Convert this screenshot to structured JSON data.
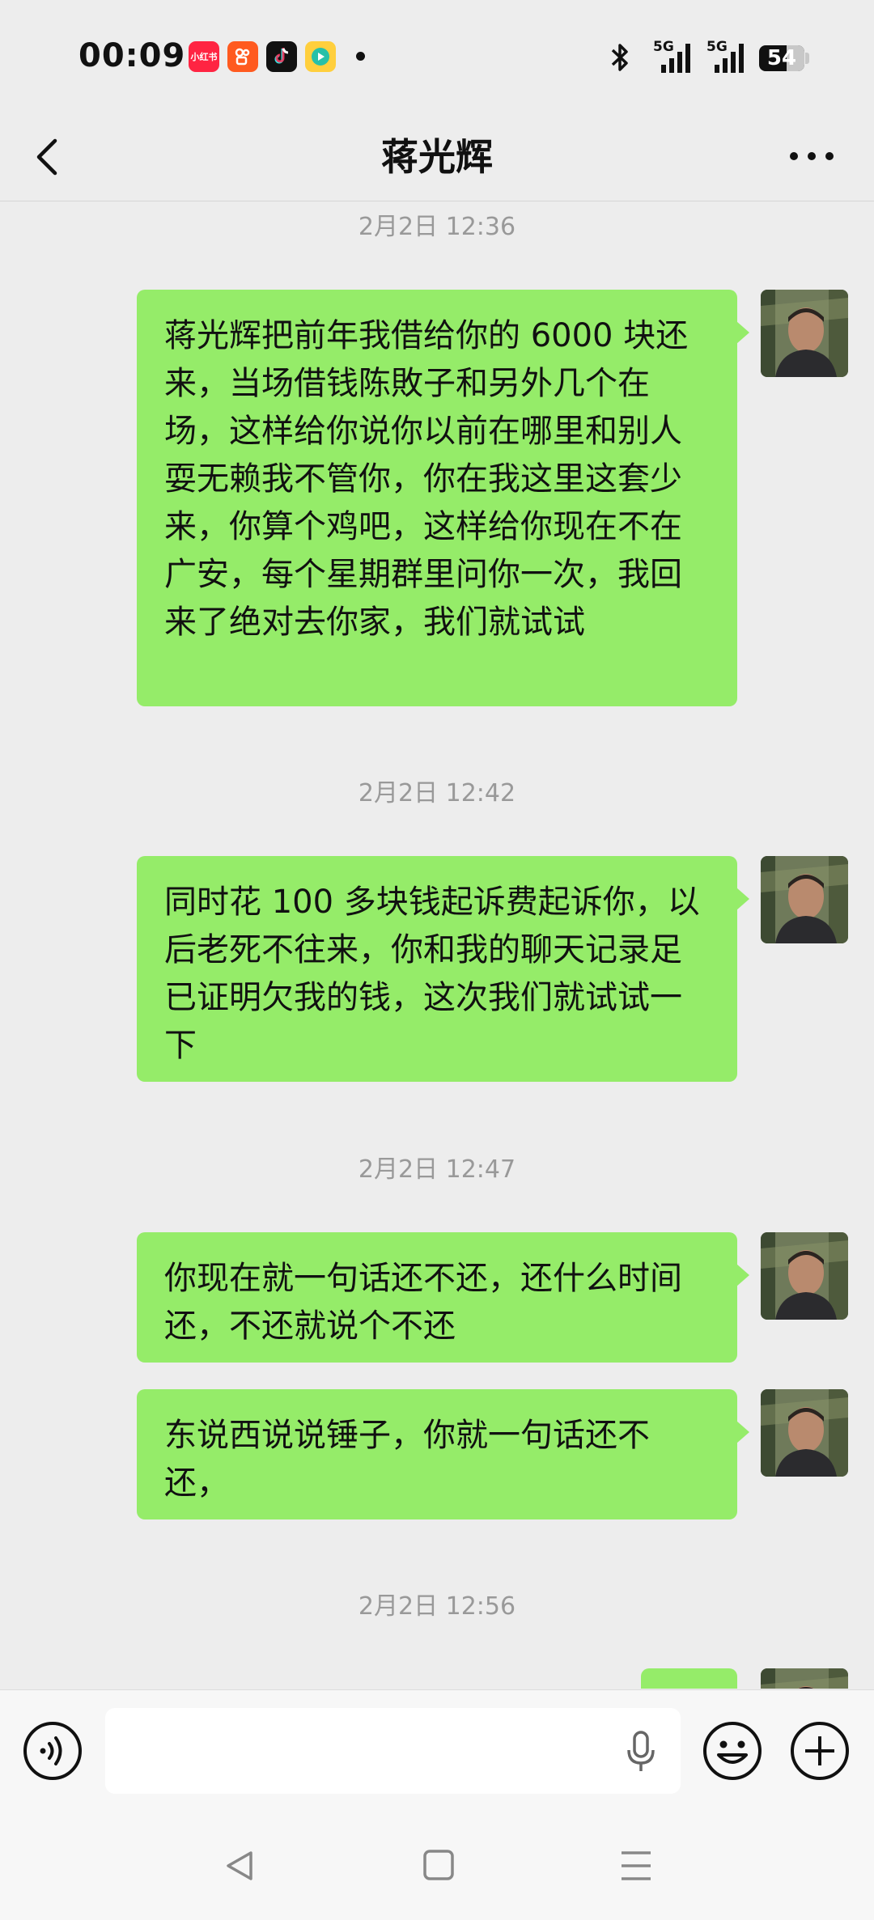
{
  "status_bar": {
    "time": "00:09",
    "app_icons": [
      "xiaohongshu-icon",
      "kuaishou-icon",
      "douyin-icon",
      "video-app-icon"
    ],
    "app_icon_label": "小红书",
    "network_1": "5G",
    "network_2": "5G",
    "battery": "54"
  },
  "header": {
    "title": "蒋光辉"
  },
  "messages": [
    {
      "timestamp": "2月2日 12:36",
      "text": "蒋光辉把前年我借给你的 6000 块还来，当场借钱陈敗子和另外几个在场，这样给你说你以前在哪里和别人耍无赖我不管你，你在我这里这套少来，你算个鸡吧，这样给你现在不在广安，每个星期群里问你一次，我回来了绝对去你家，我们就试试"
    },
    {
      "timestamp": "2月2日 12:42",
      "text": "同时花 100 多块钱起诉费起诉你，以后老死不往来，你和我的聊天记录足已证明欠我的钱，这次我们就试试一下"
    },
    {
      "timestamp": "2月2日 12:47",
      "text": "你现在就一句话还不还，还什么时间还，不还就说个不还"
    },
    {
      "timestamp": "",
      "text": "东说西说说锤子，你就一句话还不还，"
    },
    {
      "timestamp": "2月2日 12:56",
      "text": ""
    }
  ],
  "input": {
    "value": "",
    "placeholder": ""
  },
  "colors": {
    "background": "#ededed",
    "bubble": "#95ec69",
    "timestamp": "#999999"
  }
}
